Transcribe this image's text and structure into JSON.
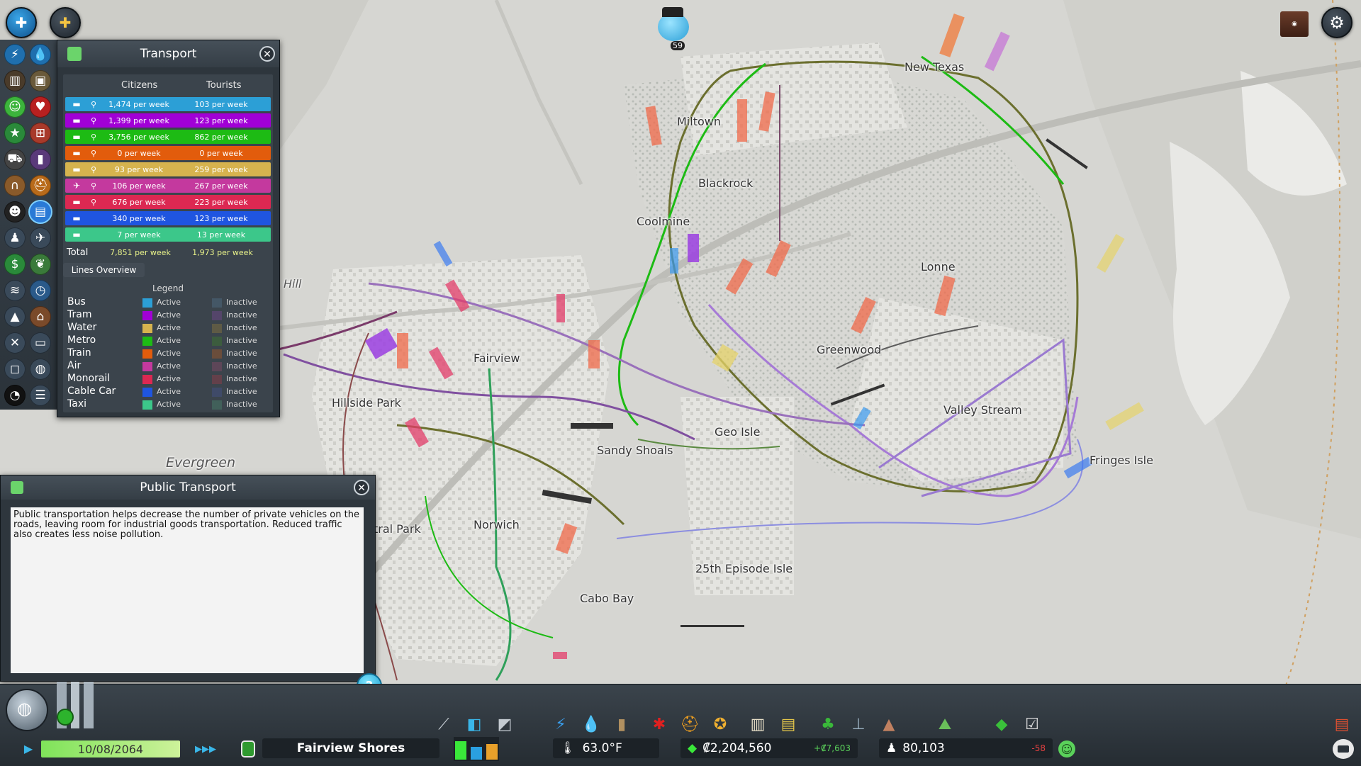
{
  "top_left": {
    "menu_icon": "main-menu-icon",
    "unlock_icon": "milestone-icon"
  },
  "chirper": {
    "count": "59"
  },
  "transport_panel": {
    "title": "Transport",
    "columns": {
      "citizens": "Citizens",
      "tourists": "Tourists"
    },
    "rows": [
      {
        "mode": "bus",
        "icon": "bus-icon",
        "color": "#2c9fd6",
        "citizens": "1,474 per week",
        "tourists": "103 per week"
      },
      {
        "mode": "tram",
        "icon": "tram-icon",
        "color": "#a100d6",
        "citizens": "1,399 per week",
        "tourists": "123 per week"
      },
      {
        "mode": "metro",
        "icon": "metro-icon",
        "color": "#1dbb14",
        "citizens": "3,756 per week",
        "tourists": "862 per week"
      },
      {
        "mode": "train",
        "icon": "train-icon",
        "color": "#e25c0c",
        "citizens": "0 per week",
        "tourists": "0 per week"
      },
      {
        "mode": "ship",
        "icon": "ship-icon",
        "color": "#d6b34e",
        "citizens": "93 per week",
        "tourists": "259 per week"
      },
      {
        "mode": "air",
        "icon": "airplane-icon",
        "color": "#c4399e",
        "citizens": "106 per week",
        "tourists": "267 per week"
      },
      {
        "mode": "monorail",
        "icon": "monorail-icon",
        "color": "#dc2852",
        "citizens": "676 per week",
        "tourists": "223 per week"
      },
      {
        "mode": "cable-car",
        "icon": "cable-car-icon",
        "color": "#1f55e0",
        "citizens": "340 per week",
        "tourists": "123 per week"
      },
      {
        "mode": "taxi",
        "icon": "taxi-icon",
        "color": "#3cc78a",
        "citizens": "7 per week",
        "tourists": "13 per week"
      }
    ],
    "total": {
      "label": "Total",
      "citizens": "7,851 per week",
      "tourists": "1,973 per week"
    },
    "lines_overview": "Lines Overview",
    "legend_title": "Legend",
    "legend": [
      {
        "name": "Bus",
        "active": "Active",
        "inactive": "Inactive",
        "active_color": "#2c9fd6",
        "inactive_color": "#445766"
      },
      {
        "name": "Tram",
        "active": "Active",
        "inactive": "Inactive",
        "active_color": "#a100d6",
        "inactive_color": "#54456a"
      },
      {
        "name": "Water",
        "active": "Active",
        "inactive": "Inactive",
        "active_color": "#d6b34e",
        "inactive_color": "#5e5a45"
      },
      {
        "name": "Metro",
        "active": "Active",
        "inactive": "Inactive",
        "active_color": "#1dbb14",
        "inactive_color": "#3c5c3e"
      },
      {
        "name": "Train",
        "active": "Active",
        "inactive": "Inactive",
        "active_color": "#e25c0c",
        "inactive_color": "#6a4d3b"
      },
      {
        "name": "Air",
        "active": "Active",
        "inactive": "Inactive",
        "active_color": "#c4399e",
        "inactive_color": "#5d4658"
      },
      {
        "name": "Monorail",
        "active": "Active",
        "inactive": "Inactive",
        "active_color": "#dc2852",
        "inactive_color": "#63404a"
      },
      {
        "name": "Cable Car",
        "active": "Active",
        "inactive": "Inactive",
        "active_color": "#1f55e0",
        "inactive_color": "#3f4a68"
      },
      {
        "name": "Taxi",
        "active": "Active",
        "inactive": "Inactive",
        "active_color": "#3cc78a",
        "inactive_color": "#41605a"
      }
    ]
  },
  "public_transport_panel": {
    "title": "Public Transport",
    "description": "Public transportation helps decrease the number of private vehicles on the roads, leaving room for industrial goods transportation. Reduced traffic also creates less noise pollution."
  },
  "districts": [
    {
      "name": "New Texas"
    },
    {
      "name": "Miltown"
    },
    {
      "name": "Blackrock"
    },
    {
      "name": "Coolmine"
    },
    {
      "name": "Lonne"
    },
    {
      "name": "Greenwood"
    },
    {
      "name": "Valley Stream"
    },
    {
      "name": "Fringes Isle"
    },
    {
      "name": "Fairview"
    },
    {
      "name": "Hillside Park"
    },
    {
      "name": "Geo Isle"
    },
    {
      "name": "Sandy Shoals"
    },
    {
      "name": "Evergreen"
    },
    {
      "name": "entral Park"
    },
    {
      "name": "Norwich"
    },
    {
      "name": "25th Episode Isle"
    },
    {
      "name": "Cabo Bay"
    },
    {
      "name": "Hill"
    }
  ],
  "bottom_bar": {
    "date": "10/08/2064",
    "city_name": "Fairview Shores",
    "temperature": "63.0°F",
    "money": "₡2,204,560",
    "money_delta": "+₡7,603",
    "population": "80,103",
    "population_delta": "-58",
    "speed_label": "▶▶▶",
    "play_label": "▶"
  },
  "colors": {
    "panel_bg": "#2e363d",
    "map_bg": "#d9d9d6",
    "accent_green": "#7fe35a"
  }
}
